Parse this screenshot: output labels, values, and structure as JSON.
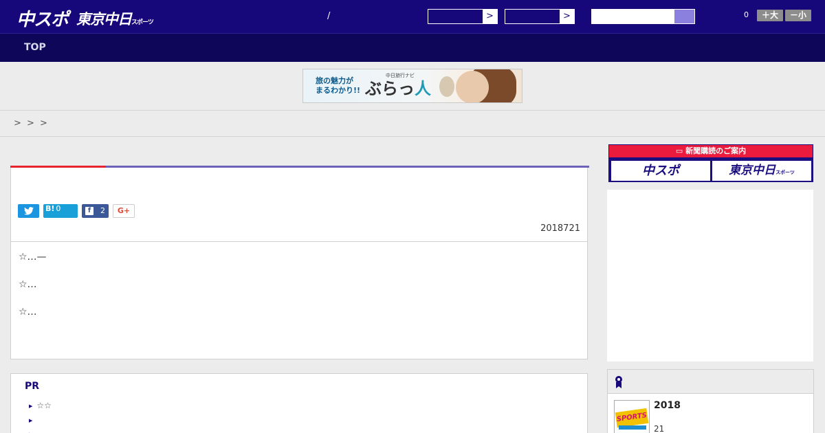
{
  "header": {
    "logo_chuspo": "中スポ",
    "logo_tokyo": "東京中日",
    "logo_tokyo_small": "スポーツ",
    "separator": "/",
    "select_arrow": ">",
    "unread_count": "0",
    "font_larger": "＋大",
    "font_smaller": "－小"
  },
  "nav": {
    "items": [
      {
        "label": "TOP"
      }
    ]
  },
  "banner": {
    "text_line1": "旅の魅力が",
    "text_line2": "まるわかり!!",
    "small": "中日旅行ナビ",
    "logo_part1": "ぶらっ",
    "logo_part2": "人"
  },
  "breadcrumb": {
    "separators": [
      ">",
      ">",
      ">"
    ]
  },
  "article": {
    "share": {
      "twitter_icon": "twitter-bird",
      "hatena_label": "B!",
      "hatena_count": "0",
      "facebook_icon": "f",
      "facebook_count": "2",
      "gplus_label": "G+"
    },
    "date": "2018721",
    "paragraphs": [
      "☆…—",
      "☆…",
      "☆…"
    ]
  },
  "pr": {
    "title": "PR",
    "items": [
      "☆☆",
      "",
      ""
    ]
  },
  "sidebar": {
    "subscribe_heading": "新聞購読のご案内",
    "subscribe_chuspo": "中スポ",
    "subscribe_tokyo": "東京中日",
    "subscribe_tokyo_small": "スポーツ",
    "ranking": {
      "thumb_text": "SPORTS",
      "year": "2018",
      "sub": "21"
    }
  },
  "colors": {
    "header_bg": "#16087a",
    "nav_bg": "#0d0659",
    "accent_red": "#e8222e",
    "accent_blue": "#6c62b8",
    "twitter": "#1b95e0",
    "hatena": "#1aa0d8",
    "facebook": "#3b5998",
    "gplus": "#dd4b39",
    "subscribe_red": "#ea1b3d"
  }
}
